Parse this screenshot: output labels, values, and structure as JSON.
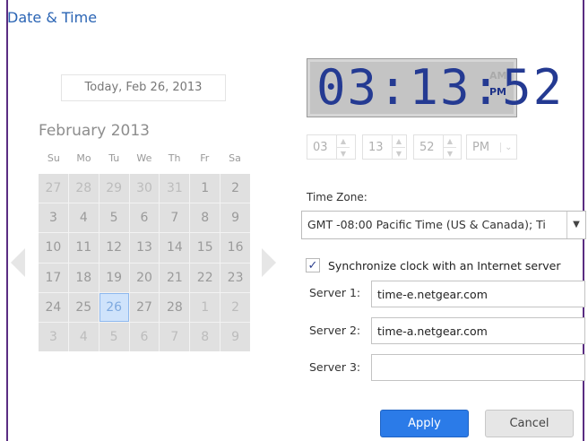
{
  "page": {
    "title": "Date & Time"
  },
  "calendar": {
    "today_text": "Today, Feb 26, 2013",
    "month_label": "February 2013",
    "weekdays": [
      "Su",
      "Mo",
      "Tu",
      "We",
      "Th",
      "Fr",
      "Sa"
    ],
    "weeks": [
      [
        "27",
        "28",
        "29",
        "30",
        "31",
        "1",
        "2"
      ],
      [
        "3",
        "4",
        "5",
        "6",
        "7",
        "8",
        "9"
      ],
      [
        "10",
        "11",
        "12",
        "13",
        "14",
        "15",
        "16"
      ],
      [
        "17",
        "18",
        "19",
        "20",
        "21",
        "22",
        "23"
      ],
      [
        "24",
        "25",
        "26",
        "27",
        "28",
        "1",
        "2"
      ],
      [
        "3",
        "4",
        "5",
        "6",
        "7",
        "8",
        "9"
      ]
    ],
    "selected_day": "26"
  },
  "clock": {
    "hours": "03",
    "minutes": "13",
    "seconds": "52",
    "am_label": "AM",
    "pm_label": "PM"
  },
  "time_inputs": {
    "hour": "03",
    "minute": "13",
    "second": "52",
    "meridiem": "PM"
  },
  "form": {
    "timezone_label": "Time Zone:",
    "timezone_value": "GMT -08:00 Pacific Time (US & Canada); Ti",
    "sync_label": "Synchronize clock with an Internet server",
    "server1_label": "Server 1:",
    "server1_value": "time-e.netgear.com",
    "server2_label": "Server 2:",
    "server2_value": "time-a.netgear.com",
    "server3_label": "Server 3:",
    "server3_value": ""
  },
  "buttons": {
    "apply": "Apply",
    "cancel": "Cancel"
  }
}
